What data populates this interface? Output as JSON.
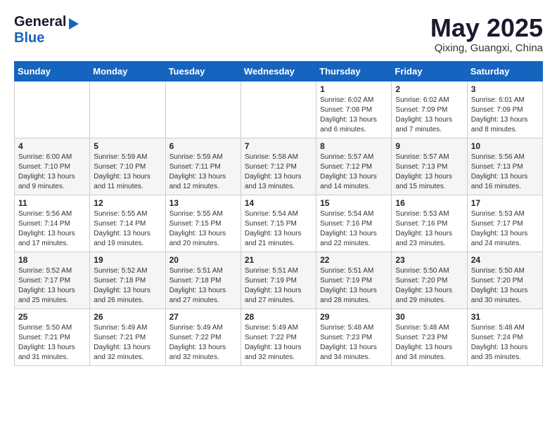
{
  "header": {
    "logo_general": "General",
    "logo_blue": "Blue",
    "month_title": "May 2025",
    "subtitle": "Qixing, Guangxi, China"
  },
  "weekdays": [
    "Sunday",
    "Monday",
    "Tuesday",
    "Wednesday",
    "Thursday",
    "Friday",
    "Saturday"
  ],
  "weeks": [
    [
      {
        "day": "",
        "info": ""
      },
      {
        "day": "",
        "info": ""
      },
      {
        "day": "",
        "info": ""
      },
      {
        "day": "",
        "info": ""
      },
      {
        "day": "1",
        "info": "Sunrise: 6:02 AM\nSunset: 7:08 PM\nDaylight: 13 hours\nand 6 minutes."
      },
      {
        "day": "2",
        "info": "Sunrise: 6:02 AM\nSunset: 7:09 PM\nDaylight: 13 hours\nand 7 minutes."
      },
      {
        "day": "3",
        "info": "Sunrise: 6:01 AM\nSunset: 7:09 PM\nDaylight: 13 hours\nand 8 minutes."
      }
    ],
    [
      {
        "day": "4",
        "info": "Sunrise: 6:00 AM\nSunset: 7:10 PM\nDaylight: 13 hours\nand 9 minutes."
      },
      {
        "day": "5",
        "info": "Sunrise: 5:59 AM\nSunset: 7:10 PM\nDaylight: 13 hours\nand 11 minutes."
      },
      {
        "day": "6",
        "info": "Sunrise: 5:59 AM\nSunset: 7:11 PM\nDaylight: 13 hours\nand 12 minutes."
      },
      {
        "day": "7",
        "info": "Sunrise: 5:58 AM\nSunset: 7:12 PM\nDaylight: 13 hours\nand 13 minutes."
      },
      {
        "day": "8",
        "info": "Sunrise: 5:57 AM\nSunset: 7:12 PM\nDaylight: 13 hours\nand 14 minutes."
      },
      {
        "day": "9",
        "info": "Sunrise: 5:57 AM\nSunset: 7:13 PM\nDaylight: 13 hours\nand 15 minutes."
      },
      {
        "day": "10",
        "info": "Sunrise: 5:56 AM\nSunset: 7:13 PM\nDaylight: 13 hours\nand 16 minutes."
      }
    ],
    [
      {
        "day": "11",
        "info": "Sunrise: 5:56 AM\nSunset: 7:14 PM\nDaylight: 13 hours\nand 17 minutes."
      },
      {
        "day": "12",
        "info": "Sunrise: 5:55 AM\nSunset: 7:14 PM\nDaylight: 13 hours\nand 19 minutes."
      },
      {
        "day": "13",
        "info": "Sunrise: 5:55 AM\nSunset: 7:15 PM\nDaylight: 13 hours\nand 20 minutes."
      },
      {
        "day": "14",
        "info": "Sunrise: 5:54 AM\nSunset: 7:15 PM\nDaylight: 13 hours\nand 21 minutes."
      },
      {
        "day": "15",
        "info": "Sunrise: 5:54 AM\nSunset: 7:16 PM\nDaylight: 13 hours\nand 22 minutes."
      },
      {
        "day": "16",
        "info": "Sunrise: 5:53 AM\nSunset: 7:16 PM\nDaylight: 13 hours\nand 23 minutes."
      },
      {
        "day": "17",
        "info": "Sunrise: 5:53 AM\nSunset: 7:17 PM\nDaylight: 13 hours\nand 24 minutes."
      }
    ],
    [
      {
        "day": "18",
        "info": "Sunrise: 5:52 AM\nSunset: 7:17 PM\nDaylight: 13 hours\nand 25 minutes."
      },
      {
        "day": "19",
        "info": "Sunrise: 5:52 AM\nSunset: 7:18 PM\nDaylight: 13 hours\nand 26 minutes."
      },
      {
        "day": "20",
        "info": "Sunrise: 5:51 AM\nSunset: 7:18 PM\nDaylight: 13 hours\nand 27 minutes."
      },
      {
        "day": "21",
        "info": "Sunrise: 5:51 AM\nSunset: 7:19 PM\nDaylight: 13 hours\nand 27 minutes."
      },
      {
        "day": "22",
        "info": "Sunrise: 5:51 AM\nSunset: 7:19 PM\nDaylight: 13 hours\nand 28 minutes."
      },
      {
        "day": "23",
        "info": "Sunrise: 5:50 AM\nSunset: 7:20 PM\nDaylight: 13 hours\nand 29 minutes."
      },
      {
        "day": "24",
        "info": "Sunrise: 5:50 AM\nSunset: 7:20 PM\nDaylight: 13 hours\nand 30 minutes."
      }
    ],
    [
      {
        "day": "25",
        "info": "Sunrise: 5:50 AM\nSunset: 7:21 PM\nDaylight: 13 hours\nand 31 minutes."
      },
      {
        "day": "26",
        "info": "Sunrise: 5:49 AM\nSunset: 7:21 PM\nDaylight: 13 hours\nand 32 minutes."
      },
      {
        "day": "27",
        "info": "Sunrise: 5:49 AM\nSunset: 7:22 PM\nDaylight: 13 hours\nand 32 minutes."
      },
      {
        "day": "28",
        "info": "Sunrise: 5:49 AM\nSunset: 7:22 PM\nDaylight: 13 hours\nand 32 minutes."
      },
      {
        "day": "29",
        "info": "Sunrise: 5:48 AM\nSunset: 7:23 PM\nDaylight: 13 hours\nand 34 minutes."
      },
      {
        "day": "30",
        "info": "Sunrise: 5:48 AM\nSunset: 7:23 PM\nDaylight: 13 hours\nand 34 minutes."
      },
      {
        "day": "31",
        "info": "Sunrise: 5:48 AM\nSunset: 7:24 PM\nDaylight: 13 hours\nand 35 minutes."
      }
    ]
  ]
}
